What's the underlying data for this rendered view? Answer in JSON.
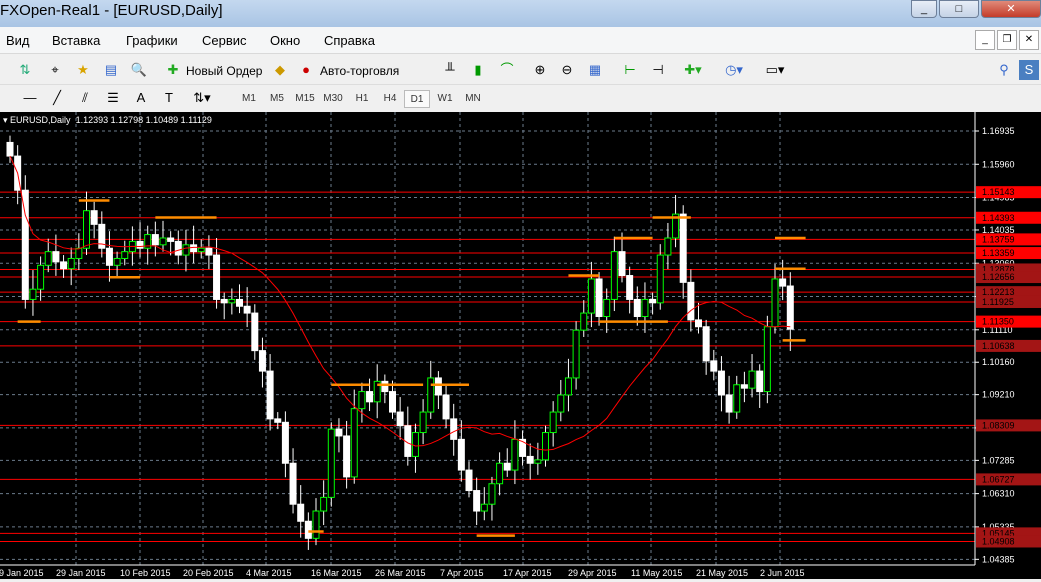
{
  "window": {
    "title": "FXOpen-Real1 - [EURUSD,Daily]",
    "min": "_",
    "max": "□",
    "close": "✕"
  },
  "menu": [
    "Вид",
    "Вставка",
    "Графики",
    "Сервис",
    "Окно",
    "Справка"
  ],
  "toolbar": {
    "new_order": "Новый Ордер",
    "auto_trading": "Авто-торговля",
    "search_placeholder": ""
  },
  "timeframes": [
    "M1",
    "M5",
    "M15",
    "M30",
    "H1",
    "H4",
    "D1",
    "W1",
    "MN"
  ],
  "active_timeframe": "D1",
  "chart": {
    "symbol_label": "EURUSD,Daily",
    "ohlc": "1.12393 1.12798 1.10489 1.11129",
    "colors": {
      "bull": "#000000",
      "bear": "#ffffff",
      "up_outline": "#00ff00",
      "ma": "#ff0000",
      "level": "#ff0000",
      "drawing": "#ff8c00"
    },
    "ma_period": 20,
    "price_grid": [
      "1.16935",
      "1.15960",
      "1.14985",
      "1.14035",
      "1.13060",
      "1.12085",
      "1.11110",
      "1.10160",
      "1.09210",
      "1.08235",
      "1.07285",
      "1.06310",
      "1.05335",
      "1.04385"
    ],
    "levels": [
      "1.15143",
      "1.14393",
      "1.13759",
      "1.13359",
      "1.12878",
      "1.12656",
      "1.12213",
      "1.11925",
      "1.11350",
      "1.10638",
      "1.08309",
      "1.06727",
      "1.05145",
      "1.04908"
    ],
    "highlight_levels": [
      "1.15143",
      "1.14393",
      "1.13759",
      "1.13359",
      "1.11350"
    ],
    "dates": [
      "19 Jan 2015",
      "29 Jan 2015",
      "10 Feb 2015",
      "20 Feb 2015",
      "4 Mar 2015",
      "16 Mar 2015",
      "26 Mar 2015",
      "7 Apr 2015",
      "17 Apr 2015",
      "29 Apr 2015",
      "11 May 2015",
      "21 May 2015",
      "2 Jun 2015"
    ],
    "closes": [
      1.162,
      1.152,
      1.12,
      1.123,
      1.13,
      1.134,
      1.131,
      1.129,
      1.132,
      1.135,
      1.146,
      1.142,
      1.135,
      1.13,
      1.132,
      1.134,
      1.137,
      1.135,
      1.139,
      1.136,
      1.138,
      1.137,
      1.133,
      1.136,
      1.134,
      1.135,
      1.133,
      1.12,
      1.119,
      1.12,
      1.118,
      1.116,
      1.105,
      1.099,
      1.085,
      1.084,
      1.072,
      1.06,
      1.055,
      1.05,
      1.058,
      1.062,
      1.082,
      1.08,
      1.068,
      1.088,
      1.093,
      1.09,
      1.096,
      1.093,
      1.087,
      1.083,
      1.074,
      1.081,
      1.087,
      1.097,
      1.092,
      1.085,
      1.079,
      1.07,
      1.064,
      1.058,
      1.06,
      1.066,
      1.072,
      1.07,
      1.079,
      1.074,
      1.072,
      1.073,
      1.081,
      1.087,
      1.092,
      1.097,
      1.111,
      1.116,
      1.126,
      1.115,
      1.12,
      1.134,
      1.127,
      1.12,
      1.115,
      1.12,
      1.119,
      1.133,
      1.138,
      1.145,
      1.125,
      1.114,
      1.112,
      1.102,
      1.099,
      1.092,
      1.087,
      1.095,
      1.094,
      1.099,
      1.093,
      1.112,
      1.126,
      1.1239,
      1.1113
    ],
    "last_bar": {
      "open": 1.12393,
      "high": 1.12798,
      "low": 1.10489,
      "close": 1.11129
    },
    "drawings": [
      [
        9,
        13,
        1.149
      ],
      [
        1,
        4,
        1.1135
      ],
      [
        13,
        17,
        1.1265
      ],
      [
        19,
        27,
        1.144
      ],
      [
        39,
        41,
        1.052
      ],
      [
        42,
        47,
        1.095
      ],
      [
        48,
        54,
        1.095
      ],
      [
        55,
        60,
        1.095
      ],
      [
        61,
        66,
        1.0508
      ],
      [
        73,
        77,
        1.127
      ],
      [
        77,
        80,
        1.1135
      ],
      [
        79,
        84,
        1.138
      ],
      [
        80,
        86,
        1.1135
      ],
      [
        84,
        89,
        1.144
      ],
      [
        100,
        104,
        1.138
      ],
      [
        100,
        104,
        1.129
      ],
      [
        101,
        104,
        1.108
      ]
    ]
  }
}
